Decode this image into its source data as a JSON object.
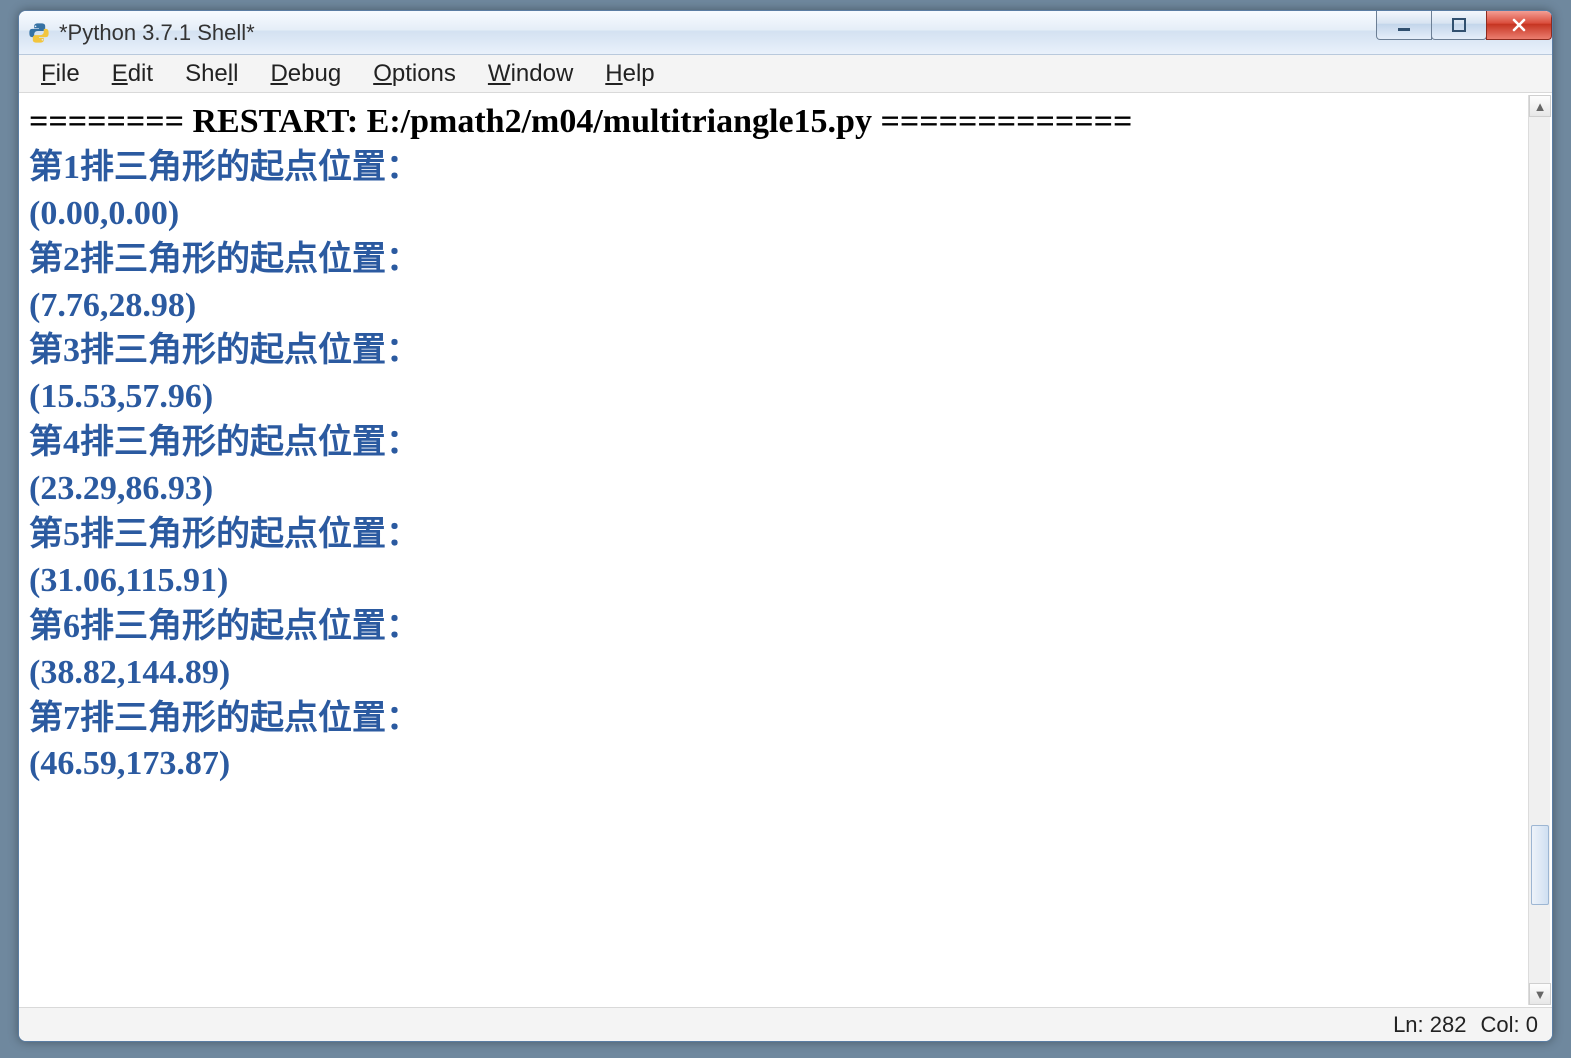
{
  "window": {
    "title": "*Python 3.7.1 Shell*"
  },
  "menu": {
    "file": "File",
    "edit": "Edit",
    "shell": "Shell",
    "debug": "Debug",
    "options": "Options",
    "window": "Window",
    "help": "Help"
  },
  "shell": {
    "restart_prefix": "========",
    "restart_label": "RESTART: E:/pmath2/m04/multitriangle15.py",
    "restart_suffix": "=============",
    "rows": [
      {
        "label": "第1排三角形的起点位置：",
        "coord": "(0.00,0.00)"
      },
      {
        "label": "第2排三角形的起点位置：",
        "coord": "(7.76,28.98)"
      },
      {
        "label": "第3排三角形的起点位置：",
        "coord": "(15.53,57.96)"
      },
      {
        "label": "第4排三角形的起点位置：",
        "coord": "(23.29,86.93)"
      },
      {
        "label": "第5排三角形的起点位置：",
        "coord": "(31.06,115.91)"
      },
      {
        "label": "第6排三角形的起点位置：",
        "coord": "(38.82,144.89)"
      },
      {
        "label": "第7排三角形的起点位置：",
        "coord": "(46.59,173.87)"
      }
    ]
  },
  "status": {
    "line_label": "Ln:",
    "line_value": "282",
    "col_label": "Col:",
    "col_value": "0"
  }
}
